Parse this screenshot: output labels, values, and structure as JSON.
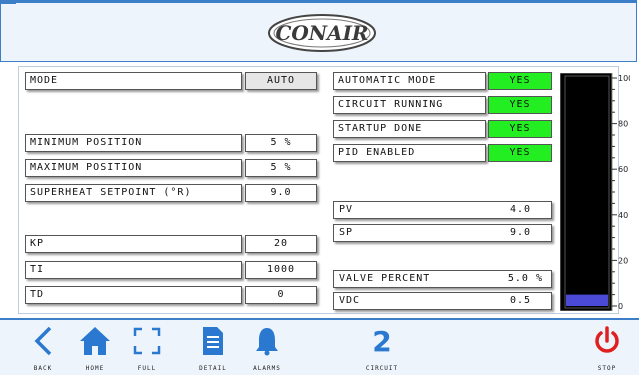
{
  "header": {
    "logo_text": "CONAIR"
  },
  "colors": {
    "accent": "#3d7ec8",
    "status_on": "#22ee22",
    "bar_fill": "#4a4ad6",
    "gauge_bg": "#000000"
  },
  "left": {
    "mode_label": "MODE",
    "mode_button": "AUTO",
    "min_pos_label": "MINIMUM POSITION",
    "min_pos_value": "5 %",
    "max_pos_label": "MAXIMUM POSITION",
    "max_pos_value": "5 %",
    "superheat_label": "SUPERHEAT SETPOINT (°R)",
    "superheat_value": "9.0",
    "kp_label": "KP",
    "kp_value": "20",
    "ti_label": "TI",
    "ti_value": "1000",
    "td_label": "TD",
    "td_value": "0"
  },
  "right": {
    "status_items": [
      {
        "label": "AUTOMATIC MODE",
        "value": "YES"
      },
      {
        "label": "CIRCUIT RUNNING",
        "value": "YES"
      },
      {
        "label": "STARTUP DONE",
        "value": "YES"
      },
      {
        "label": "PID ENABLED",
        "value": "YES"
      }
    ],
    "pv_label": "PV",
    "pv_value": "4.0",
    "sp_label": "SP",
    "sp_value": "9.0",
    "valve_label": "VALVE PERCENT",
    "valve_value": "5.0 %",
    "vdc_label": "VDC",
    "vdc_value": "0.5"
  },
  "gauge": {
    "ticks": [
      "100",
      "80",
      "60",
      "40",
      "20",
      "0"
    ],
    "level_percent": 5
  },
  "footer": {
    "back": "BACK",
    "home": "HOME",
    "full": "FULL",
    "detail": "DETAIL",
    "alarms": "ALARMS",
    "circuit_number": "2",
    "circuit": "CIRCUIT",
    "stop": "STOP"
  }
}
